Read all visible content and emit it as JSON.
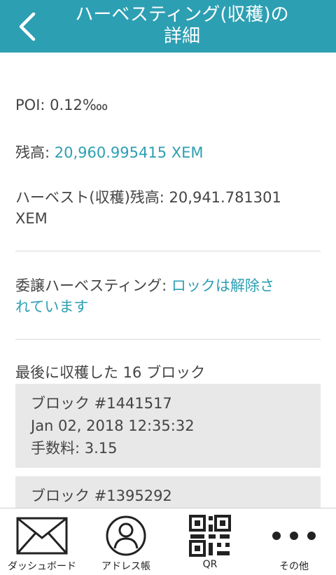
{
  "header": {
    "title_line1": "ハーベスティング(収穫)の",
    "title_line2": "詳細"
  },
  "details": {
    "poi": "POI: 0.12‱",
    "balance_label": "残高: ",
    "balance_value": "20,960.995415 XEM",
    "harvest_balance_line1": "ハーベスト(収穫)残高: 20,941.781301",
    "harvest_balance_line2": "XEM",
    "delegated_label": "委譲ハーベスティング: ",
    "delegated_status_line1": "ロックは解除さ",
    "delegated_status_line2": "れています"
  },
  "blocks": {
    "heading": "最後に収穫した 16 ブロック",
    "items": [
      {
        "block": "ブロック #1441517",
        "date": "Jan 02, 2018 12:35:32",
        "fee": "手数料: 3.15"
      },
      {
        "block": "ブロック #1395292"
      }
    ]
  },
  "tabbar": {
    "dashboard": "ダッシュボード",
    "address_book": "アドレス帳",
    "qr": "QR",
    "other": "その他"
  },
  "colors": {
    "accent": "#2d9fb3",
    "card": "#e8e8e8",
    "text": "#444444"
  }
}
